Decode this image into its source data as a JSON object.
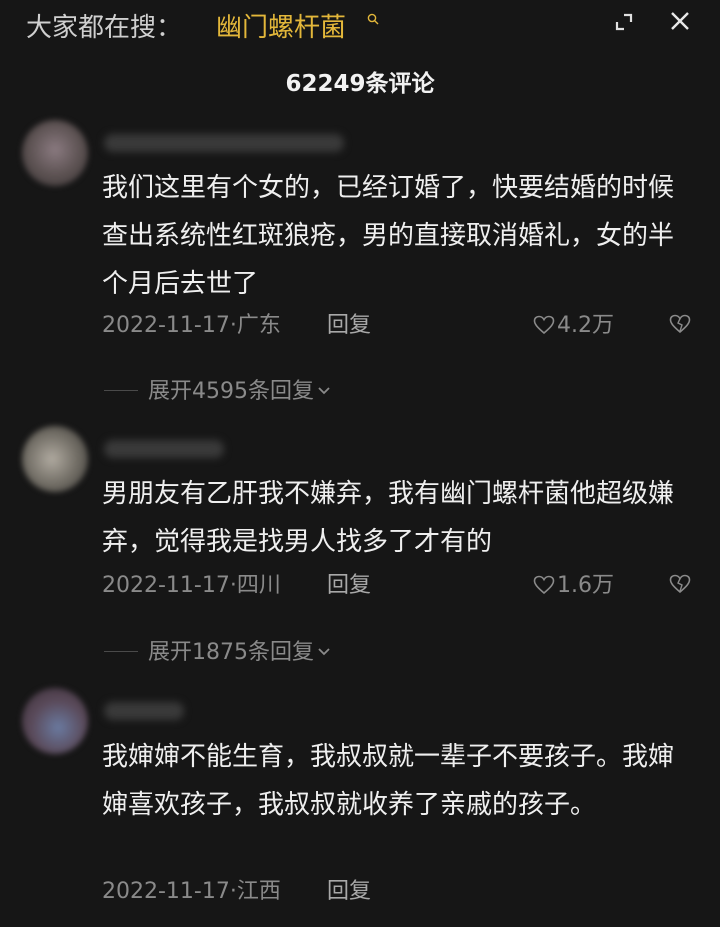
{
  "header": {
    "search_prefix": "大家都在搜：",
    "search_term": "幽门螺杆菌",
    "search_icon": "search-small-icon",
    "expand_icon": "expand-icon",
    "close_icon": "close-icon",
    "comment_count": "62249条评论"
  },
  "comments": [
    {
      "text": "我们这里有个女的，已经订婚了，快要结婚的时候查出系统性红斑狼疮，男的直接取消婚礼，女的半个月后去世了",
      "meta": "2022-11-17·广东",
      "reply_label": "回复",
      "likes": "4.2万",
      "expand_label": "展开4595条回复"
    },
    {
      "text": "男朋友有乙肝我不嫌弃，我有幽门螺杆菌他超级嫌弃，觉得我是找男人找多了才有的",
      "meta": "2022-11-17·四川",
      "reply_label": "回复",
      "likes": "1.6万",
      "expand_label": "展开1875条回复"
    },
    {
      "text": "我婶婶不能生育，我叔叔就一辈子不要孩子。我婶婶喜欢孩子，我叔叔就收养了亲戚的孩子。",
      "meta": "2022-11-17·江西",
      "reply_label": "回复"
    }
  ],
  "colors": {
    "background": "#161616",
    "search_term": "#e3b73a",
    "meta_text": "#8a8a8a"
  }
}
